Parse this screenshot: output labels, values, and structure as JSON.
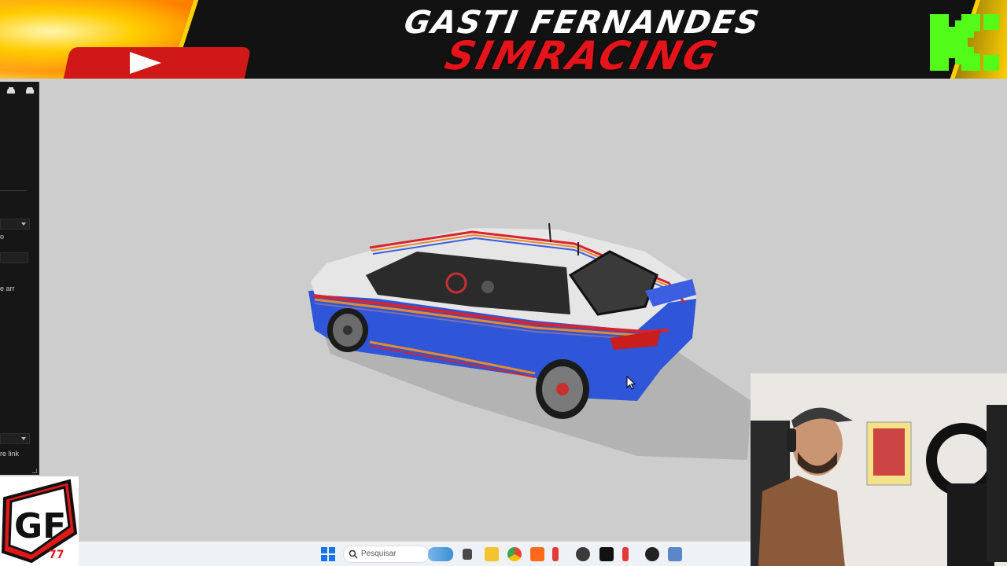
{
  "banner": {
    "line1": "GASTI FERNANDES",
    "line2": "SIMRACING",
    "youtube_icon": "youtube-play-icon",
    "kick_icon": "kick-logo-icon"
  },
  "left_panel": {
    "icons": [
      "car-icon",
      "car-front-icon"
    ],
    "truncated_text_1": "o",
    "truncated_text_2": "e arr",
    "truncated_text_3": "re link"
  },
  "taskbar": {
    "search_placeholder": "Pesquisar",
    "apps": [
      "windows-start-icon",
      "search-icon",
      "weather-widget-icon",
      "task-view-icon",
      "file-explorer-icon",
      "chrome-icon",
      "app-orange-icon",
      "app-red-pen-icon",
      "obs-icon",
      "terminal-icon",
      "app-red-pen2-icon",
      "app-round-icon",
      "app-paint-icon"
    ]
  },
  "overlay": {
    "gf_logo_text": "GF",
    "gf_logo_number": "77"
  },
  "colors": {
    "car_blue": "#2f55d8",
    "car_white": "#e8e8e8",
    "stripe_red": "#d8242a",
    "stripe_orange": "#e98a2a",
    "viewport_bg": "#cdcdcd",
    "kick_green": "#53fc18"
  }
}
